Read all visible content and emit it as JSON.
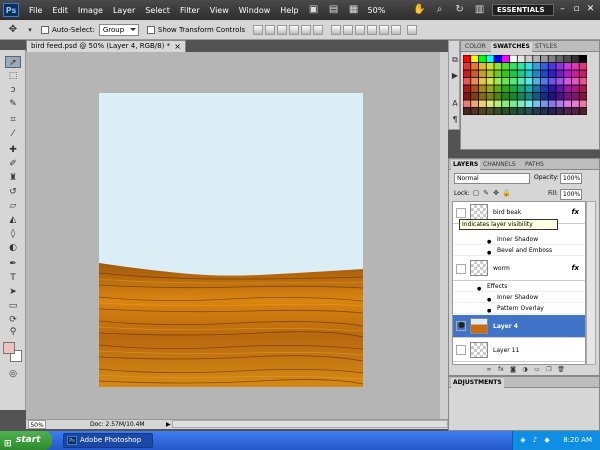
{
  "menubar": {
    "logo": "Ps",
    "items": [
      "File",
      "Edit",
      "Image",
      "Layer",
      "Select",
      "Filter",
      "View",
      "Window",
      "Help"
    ],
    "zoom": "50%",
    "workspace": "ESSENTIALS"
  },
  "options": {
    "auto_select_label": "Auto-Select:",
    "auto_select_value": "Group",
    "transform_label": "Show Transform Controls"
  },
  "document": {
    "tab_title": "bird feed.psd @ 50% (Layer 4, RGB/8) *",
    "status_zoom": "50%",
    "status_doc": "Doc: 2.57M/10.4M"
  },
  "colors": {
    "foreground": "#f1c1c1",
    "background": "#ffffff",
    "sky": "#dbeef6",
    "selection": "#3f74c9"
  },
  "swatches": {
    "tabs": [
      "COLOR",
      "SWATCHES",
      "STYLES"
    ]
  },
  "layers": {
    "tabs": [
      "LAYERS",
      "CHANNELS",
      "PATHS"
    ],
    "blend_mode": "Normal",
    "opacity_label": "Opacity:",
    "opacity": "100%",
    "lock_label": "Lock:",
    "fill_label": "Fill:",
    "fill": "100%",
    "tooltip": "Indicates layer visibility",
    "rows": [
      {
        "name": "bird beak",
        "fx": "fx"
      },
      {
        "name": "worm",
        "fx": "fx"
      },
      {
        "name": "Layer 4"
      },
      {
        "name": "Layer 11"
      }
    ],
    "effects_beak": [
      "Inner Shadow",
      "Bevel and Emboss"
    ],
    "effects_worm": [
      "Effects",
      "Inner Shadow",
      "Pattern Overlay"
    ]
  },
  "adjustments": {
    "tab": "ADJUSTMENTS"
  },
  "taskbar": {
    "start": "start",
    "task": "Adobe Photoshop CS...",
    "clock": "8:20 AM"
  }
}
